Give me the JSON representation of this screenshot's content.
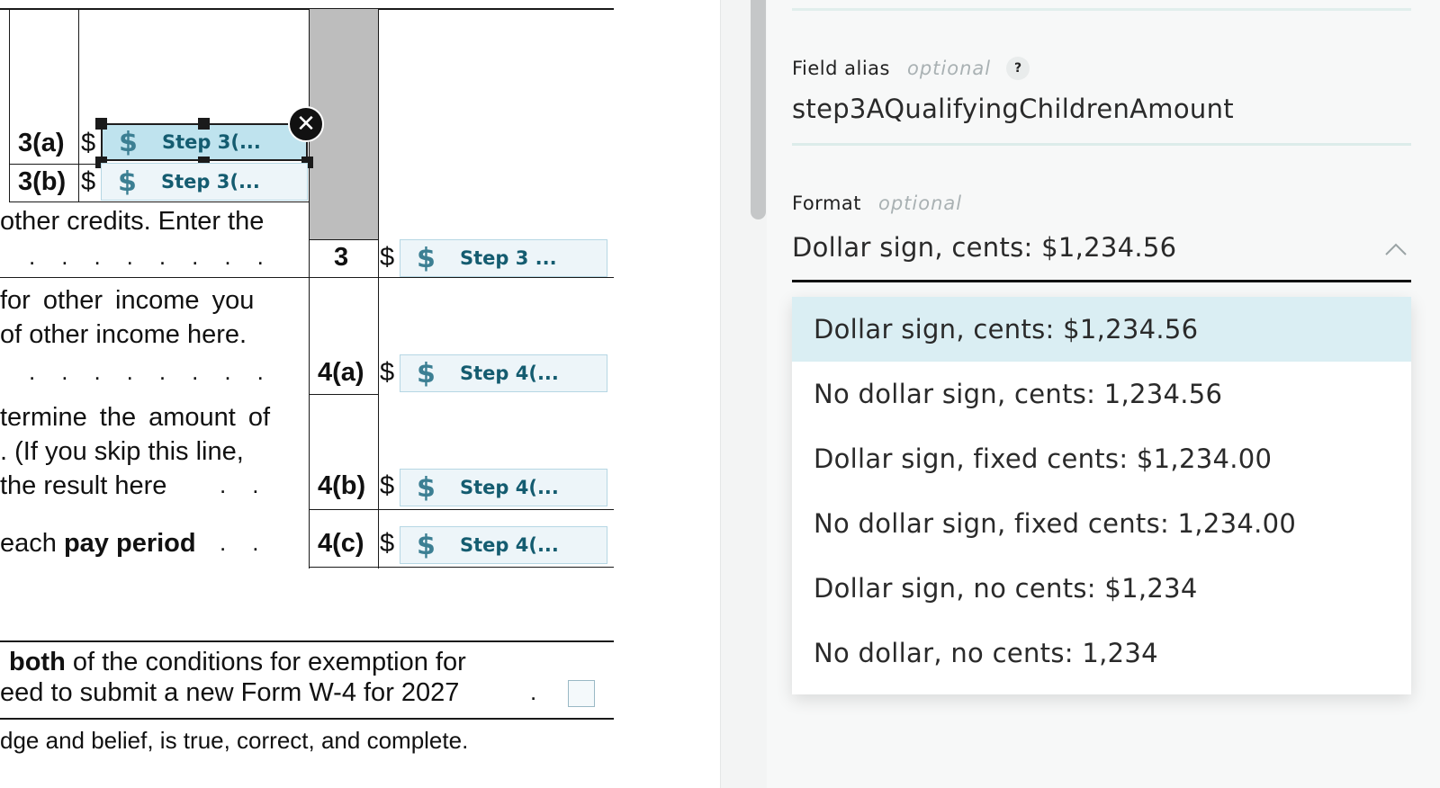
{
  "document": {
    "rows": {
      "r3a": {
        "label": "3(a)",
        "dollar": "$",
        "field": "Step 3(..."
      },
      "r3b": {
        "label": "3(b)",
        "dollar": "$",
        "field": "Step 3(..."
      },
      "r3": {
        "text": "other credits. Enter the",
        "label": "3",
        "dollar": "$",
        "field": "Step 3 ..."
      },
      "r4a": {
        "text1": "for other income you",
        "text2": "of other income here.",
        "label": "4(a)",
        "dollar": "$",
        "field": "Step 4(..."
      },
      "r4b": {
        "text1": "termine the amount of",
        "text2": ". (If you skip this line,",
        "text3": "the result here",
        "label": "4(b)",
        "dollar": "$",
        "field": "Step 4(..."
      },
      "r4c": {
        "text_pre": "each",
        "text_bold": "pay period",
        "label": "4(c)",
        "dollar": "$",
        "field": "Step 4(..."
      }
    },
    "exemption": {
      "bold": "both",
      "line1": "of the conditions for exemption for",
      "line2": "eed to submit a new Form W-4 for 2027"
    },
    "declaration": "dge and belief, is true, correct, and complete.",
    "dollar_icon": "$",
    "close_icon": "✕"
  },
  "panel": {
    "field_alias": {
      "label": "Field alias",
      "optional": "optional",
      "help": "?",
      "value": "step3AQualifyingChildrenAmount"
    },
    "format": {
      "label": "Format",
      "optional": "optional",
      "selected": "Dollar sign, cents: $1,234.56",
      "options": [
        "Dollar sign, cents: $1,234.56",
        "No dollar sign, cents: 1,234.56",
        "Dollar sign, fixed cents: $1,234.00",
        "No dollar sign, fixed cents: 1,234.00",
        "Dollar sign, no cents: $1,234",
        "No dollar, no cents: 1,234"
      ]
    }
  },
  "colors": {
    "field_bg": "#edf5f9",
    "field_selected_bg": "#bfe3ee",
    "accent_text": "#145c70",
    "active_option_bg": "#daeef3"
  }
}
